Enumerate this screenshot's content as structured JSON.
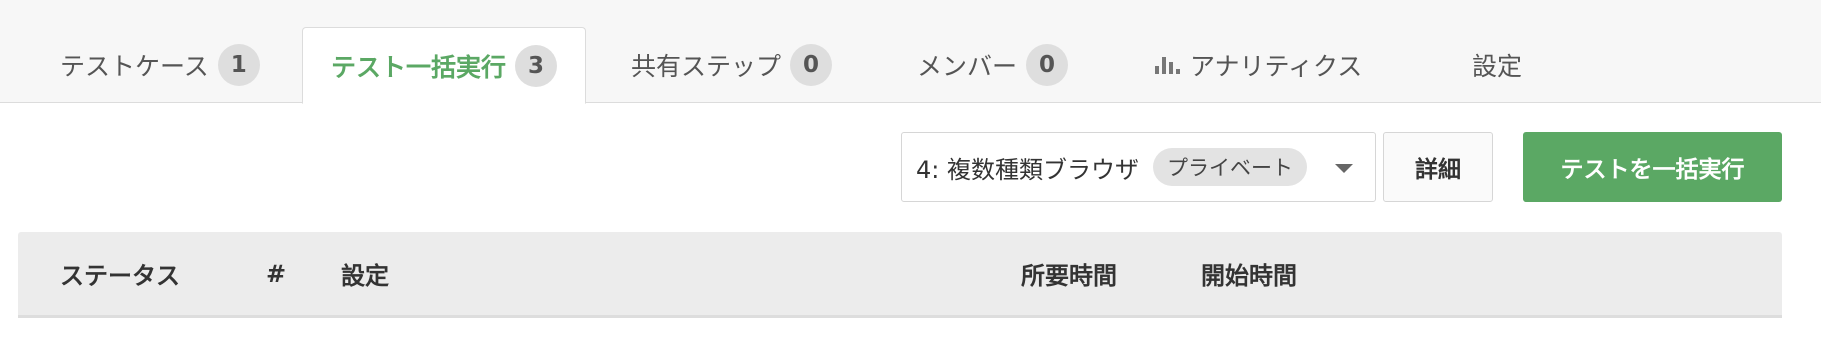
{
  "tabs": [
    {
      "label": "テストケース",
      "count": "1"
    },
    {
      "label": "テスト一括実行",
      "count": "3"
    },
    {
      "label": "共有ステップ",
      "count": "0"
    },
    {
      "label": "メンバー",
      "count": "0"
    },
    {
      "label": "アナリティクス",
      "icon": "bar-chart-icon"
    },
    {
      "label": "設定"
    }
  ],
  "toolbar": {
    "run_select": {
      "value": "4: 複数種類ブラウザ",
      "visibility": "プライベート"
    },
    "detail_label": "詳細",
    "run_label": "テストを一括実行"
  },
  "table": {
    "columns": [
      "ステータス",
      "#",
      "設定",
      "所要時間",
      "開始時間"
    ]
  },
  "colors": {
    "accent": "#5ba864",
    "tab_bar_bg": "#f7f7f7",
    "badge_bg": "#dedede",
    "table_header_bg": "#ececec"
  }
}
